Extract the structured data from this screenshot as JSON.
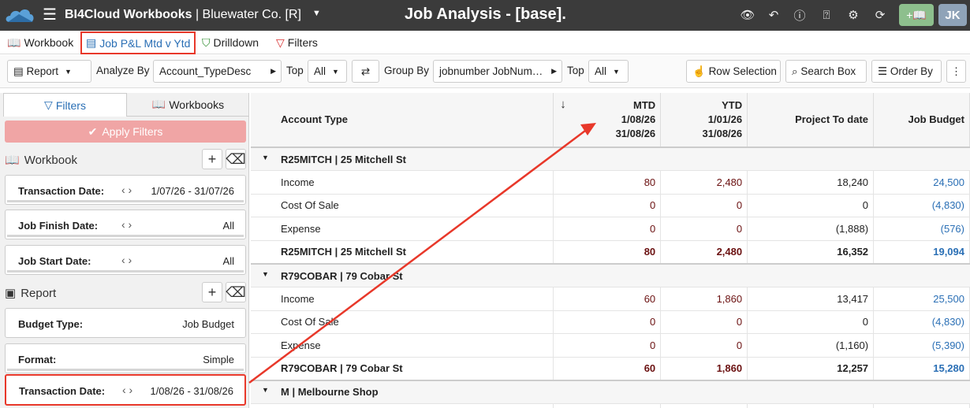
{
  "app": {
    "title": "BI4Cloud Workbooks",
    "company": "| Bluewater Co. [R]",
    "page_title": "Job Analysis - [base].",
    "avatar": "JK",
    "book_button": "+📖"
  },
  "tabs": [
    {
      "label": "Workbook"
    },
    {
      "label": "Job P&L Mtd v Ytd"
    },
    {
      "label": "Drilldown"
    },
    {
      "label": "Filters"
    }
  ],
  "toolbar": {
    "report": "Report",
    "analyze_by_label": "Analyze By",
    "analyze_by_value": "Account_TypeDesc",
    "top_label": "Top",
    "top_value": "All",
    "group_by_label": "Group By",
    "group_by_value": "jobnumber JobNum…",
    "top2_label": "Top",
    "top2_value": "All",
    "row_selection": "Row Selection",
    "search_box": "Search Box",
    "order_by": "Order By"
  },
  "sidebar": {
    "tab_filters": "Filters",
    "tab_workbooks": "Workbooks",
    "apply": "Apply Filters",
    "workbook_section": "Workbook",
    "report_section": "Report",
    "filters": [
      {
        "label": "Transaction Date:",
        "value": "1/07/26 - 31/07/26"
      },
      {
        "label": "Job Finish Date:",
        "value": "All"
      },
      {
        "label": "Job Start Date:",
        "value": "All"
      },
      {
        "label": "Budget Type:",
        "value": "Job Budget"
      },
      {
        "label": "Format:",
        "value": "Simple"
      },
      {
        "label": "Transaction Date:",
        "value": "1/08/26 - 31/08/26"
      }
    ]
  },
  "grid": {
    "headers": {
      "account": "Account Type",
      "mtd": [
        "MTD",
        "1/08/26",
        "31/08/26"
      ],
      "ytd": [
        "YTD",
        "1/01/26",
        "31/08/26"
      ],
      "ptd": "Project To date",
      "budget": "Job Budget"
    },
    "sort_arrow": "↓",
    "rows": [
      {
        "kind": "grp",
        "label": "R25MITCH | 25 Mitchell St"
      },
      {
        "kind": "row",
        "label": "Income",
        "mtd": "80",
        "ytd": "2,480",
        "ptd": "18,240",
        "bud": "24,500"
      },
      {
        "kind": "row",
        "label": "Cost Of Sale",
        "mtd": "0",
        "ytd": "0",
        "ptd": "0",
        "bud": "(4,830)"
      },
      {
        "kind": "row",
        "label": "Expense",
        "mtd": "0",
        "ytd": "0",
        "ptd": "(1,888)",
        "bud": "(576)"
      },
      {
        "kind": "tot",
        "label": "R25MITCH  |  25 Mitchell St",
        "mtd": "80",
        "ytd": "2,480",
        "ptd": "16,352",
        "bud": "19,094"
      },
      {
        "kind": "grp",
        "label": "R79COBAR | 79 Cobar St"
      },
      {
        "kind": "row",
        "label": "Income",
        "mtd": "60",
        "ytd": "1,860",
        "ptd": "13,417",
        "bud": "25,500"
      },
      {
        "kind": "row",
        "label": "Cost Of Sale",
        "mtd": "0",
        "ytd": "0",
        "ptd": "0",
        "bud": "(4,830)"
      },
      {
        "kind": "row",
        "label": "Expense",
        "mtd": "0",
        "ytd": "0",
        "ptd": "(1,160)",
        "bud": "(5,390)"
      },
      {
        "kind": "tot",
        "label": "R79COBAR  |  79 Cobar St",
        "mtd": "60",
        "ytd": "1,860",
        "ptd": "12,257",
        "bud": "15,280"
      },
      {
        "kind": "grp",
        "label": "M | Melbourne Shop"
      },
      {
        "kind": "row",
        "label": "",
        "mtd": "",
        "ytd": "",
        "ptd": "",
        "bud": ""
      }
    ]
  },
  "colors": {
    "accent": "#2a6fb5",
    "highlight": "#e8382a",
    "topbar": "#3b3b3b"
  }
}
